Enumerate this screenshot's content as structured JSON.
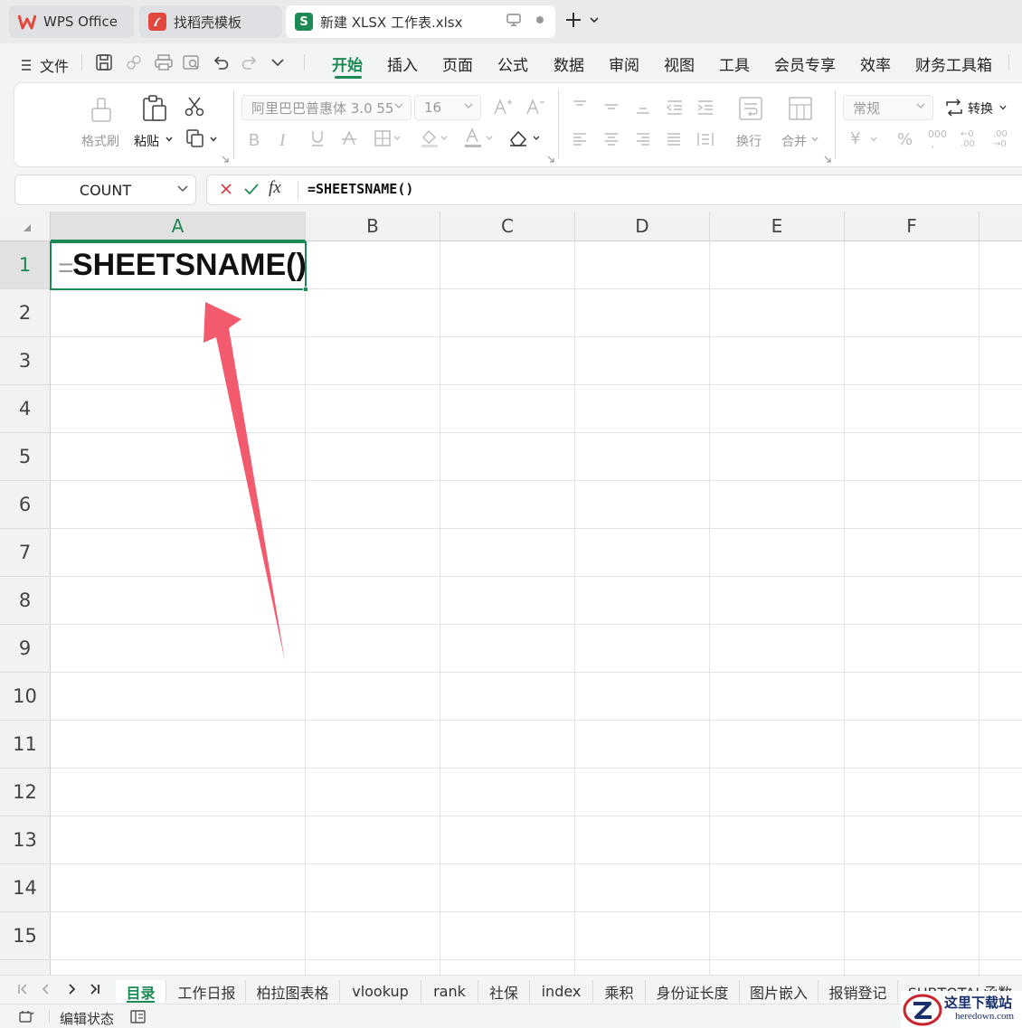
{
  "titlebar": {
    "tabs": [
      {
        "label": "WPS Office"
      },
      {
        "label": "找稻壳模板"
      },
      {
        "label": "新建 XLSX 工作表.xlsx",
        "icon_letter": "S"
      }
    ]
  },
  "menu": {
    "file_label": "文件",
    "items": [
      "开始",
      "插入",
      "页面",
      "公式",
      "数据",
      "审阅",
      "视图",
      "工具",
      "会员专享",
      "效率",
      "财务工具箱"
    ],
    "active": "开始"
  },
  "ribbon": {
    "format_painter": "格式刷",
    "paste": "粘贴",
    "font_name": "阿里巴巴普惠体 3.0 55",
    "font_size": "16",
    "wrap": "换行",
    "merge": "合并",
    "number_format": "常规",
    "convert": "转换"
  },
  "formula_bar": {
    "name_box": "COUNT",
    "fx_label": "fx",
    "formula": "=SHEETSNAME()"
  },
  "grid": {
    "columns": [
      "A",
      "B",
      "C",
      "D",
      "E",
      "F"
    ],
    "rows": [
      "1",
      "2",
      "3",
      "4",
      "5",
      "6",
      "7",
      "8",
      "9",
      "10",
      "11",
      "12",
      "13",
      "14",
      "15"
    ],
    "active_cell": {
      "eq": "=",
      "text": "SHEETSNAME()"
    }
  },
  "sheets": {
    "tabs": [
      "目录",
      "工作日报",
      "柏拉图表格",
      "vlookup",
      "rank",
      "社保",
      "index",
      "乘积",
      "身份证长度",
      "图片嵌入",
      "报销登记",
      "SUBTOTAL函数"
    ],
    "active": "目录"
  },
  "status": {
    "mode": "编辑状态"
  },
  "watermark": {
    "title": "这里下载站",
    "url": "heredown.com"
  },
  "colors": {
    "accent": "#1b8a52",
    "arrow": "#f25a6e",
    "wps_red": "#e2473e"
  }
}
